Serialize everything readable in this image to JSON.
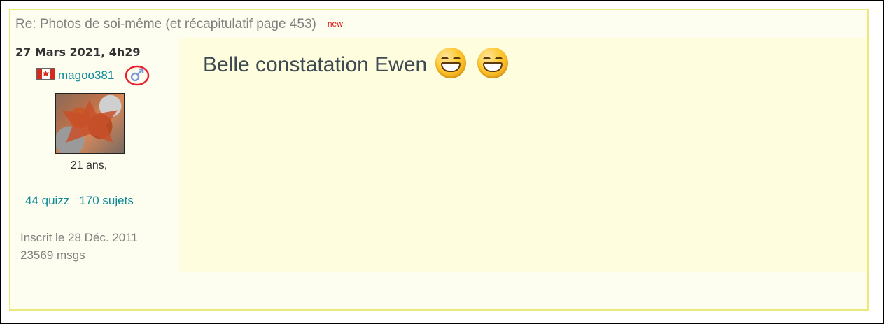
{
  "post": {
    "title": "Re: Photos de soi-même (et récapitulatif page 453)",
    "new_badge": "new",
    "date": "27 Mars 2021, 4h29",
    "message": "Belle constatation Ewen"
  },
  "author": {
    "flag_icon": "canada-flag-icon",
    "username": "magoo381",
    "gender_icon": "male-gender-icon",
    "age": "21 ans,",
    "quizz": "44 quizz",
    "sujets": "170 sujets",
    "joined": "Inscrit le 28 Déc. 2011",
    "messages": "23569 msgs"
  },
  "emoji": [
    "grinning-face-icon",
    "grinning-face-icon"
  ],
  "colors": {
    "accent": "#0e8c98",
    "border": "#ece87a",
    "new_badge": "#e01010",
    "annotation_circle": "#e8222e"
  }
}
